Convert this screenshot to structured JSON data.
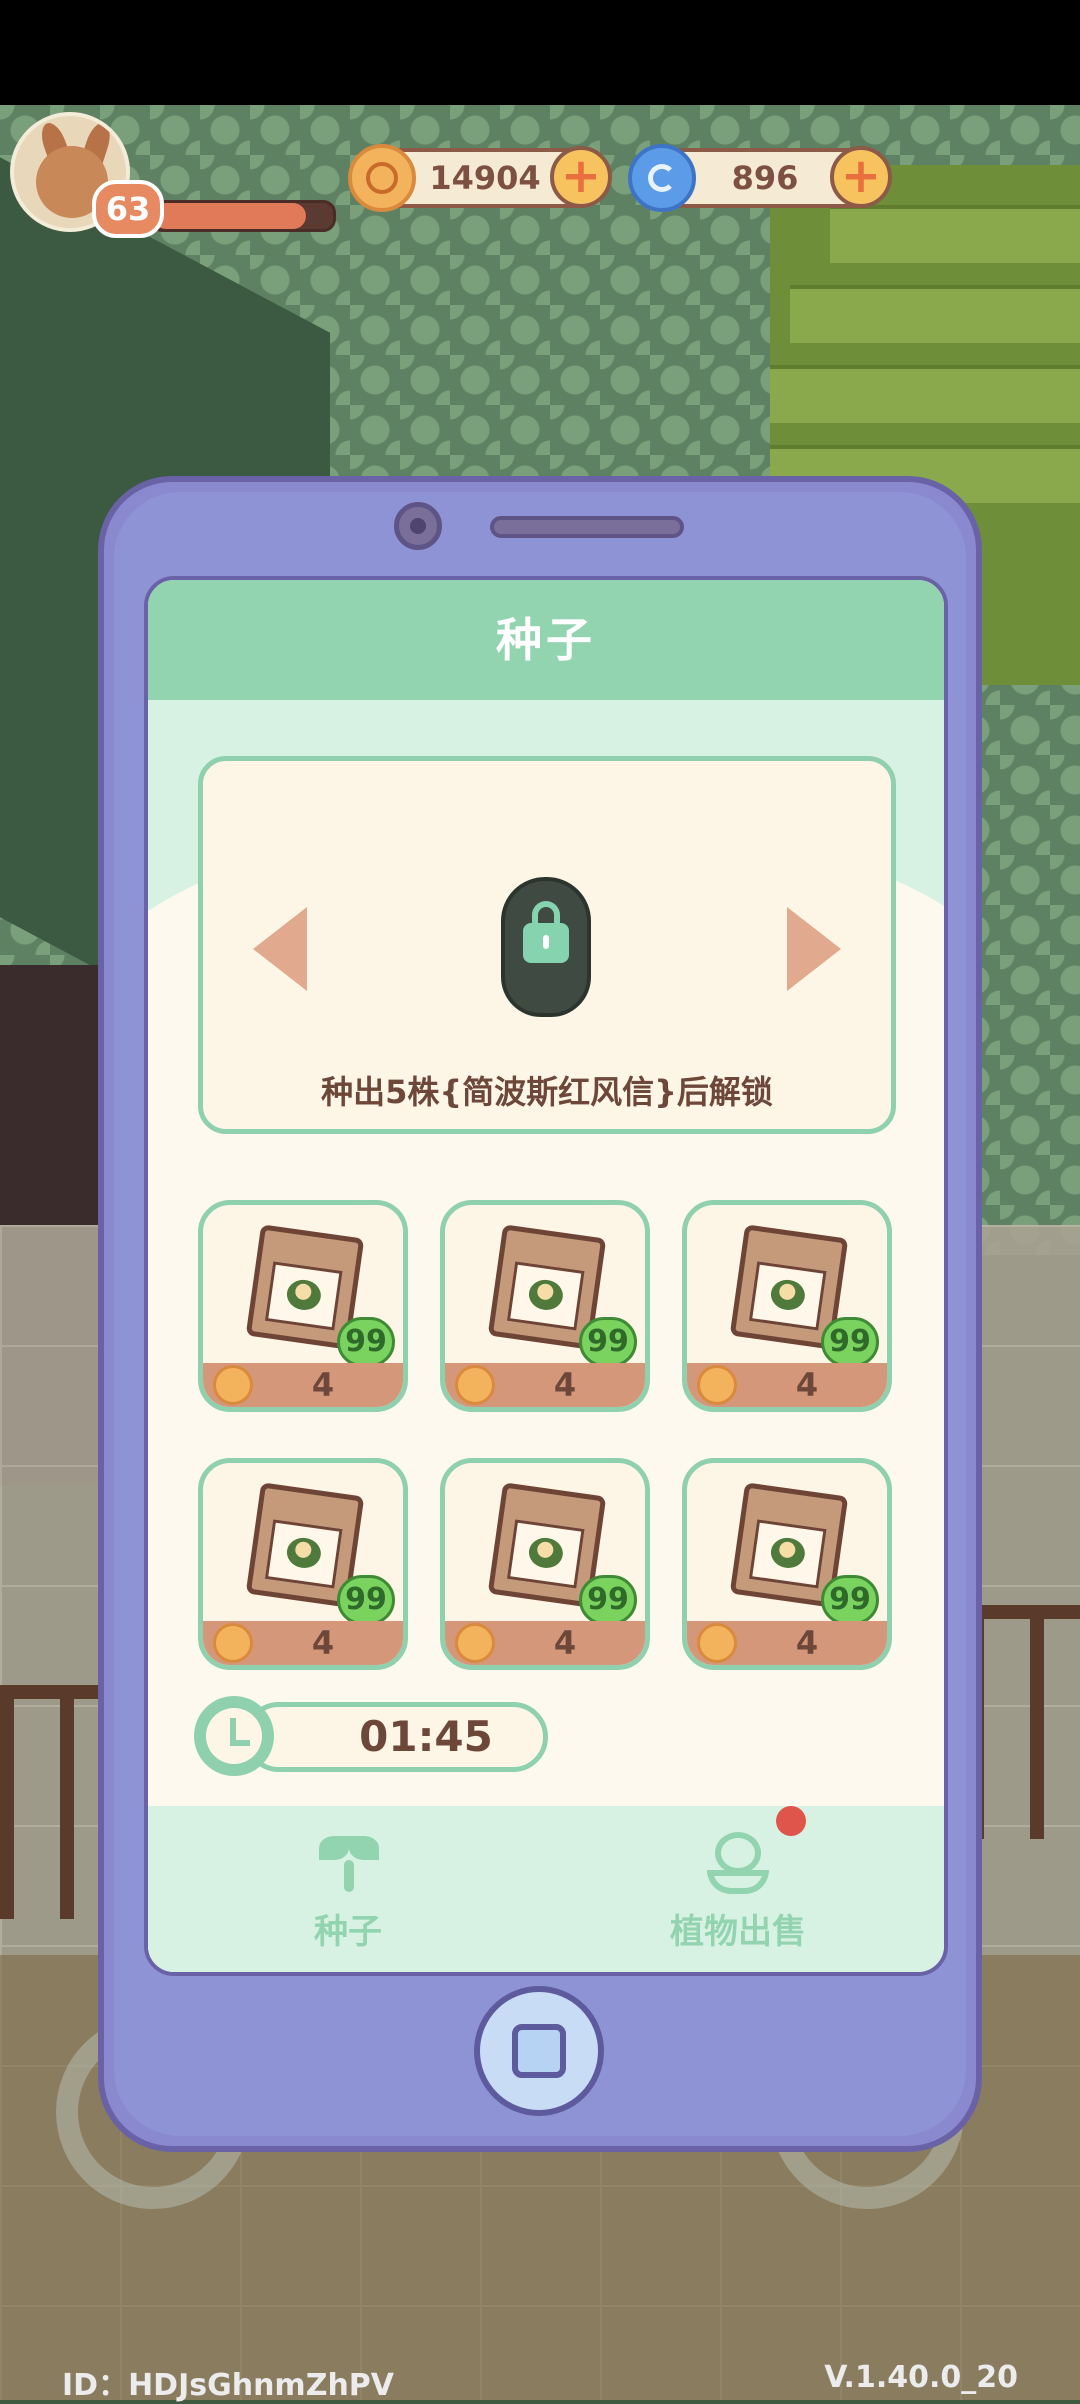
{
  "hud": {
    "player_level": "63",
    "hp_fraction": 0.85,
    "coins": "14904",
    "gems": "896",
    "coin_icon": "coin-icon",
    "gem_icon": "swirl-gem-icon"
  },
  "panel": {
    "title": "种子",
    "featured": {
      "status_icon": "lock-icon",
      "unlock_text": "种出5株{简波斯红风信}后解锁"
    },
    "seeds": [
      {
        "count": "99",
        "price": "4",
        "icon": "seed-bag-icon"
      },
      {
        "count": "99",
        "price": "4",
        "icon": "seed-bag-icon"
      },
      {
        "count": "99",
        "price": "4",
        "icon": "seed-bag-icon"
      },
      {
        "count": "99",
        "price": "4",
        "icon": "seed-bag-icon"
      },
      {
        "count": "99",
        "price": "4",
        "icon": "seed-bag-icon"
      },
      {
        "count": "99",
        "price": "4",
        "icon": "seed-bag-icon"
      }
    ],
    "refresh_timer": "01:45",
    "nav": {
      "seeds_label": "种子",
      "sell_label": "植物出售",
      "sell_has_notification": true
    }
  },
  "footer": {
    "player_id": "ID：HDJsGhnmZhPV",
    "version": "V.1.40.0_20"
  },
  "colors": {
    "accent_green": "#93d4b0",
    "phone_purple": "#8a88cf",
    "text_brown": "#6c473a",
    "price_bar": "#d59779",
    "notification": "#e0554b"
  }
}
